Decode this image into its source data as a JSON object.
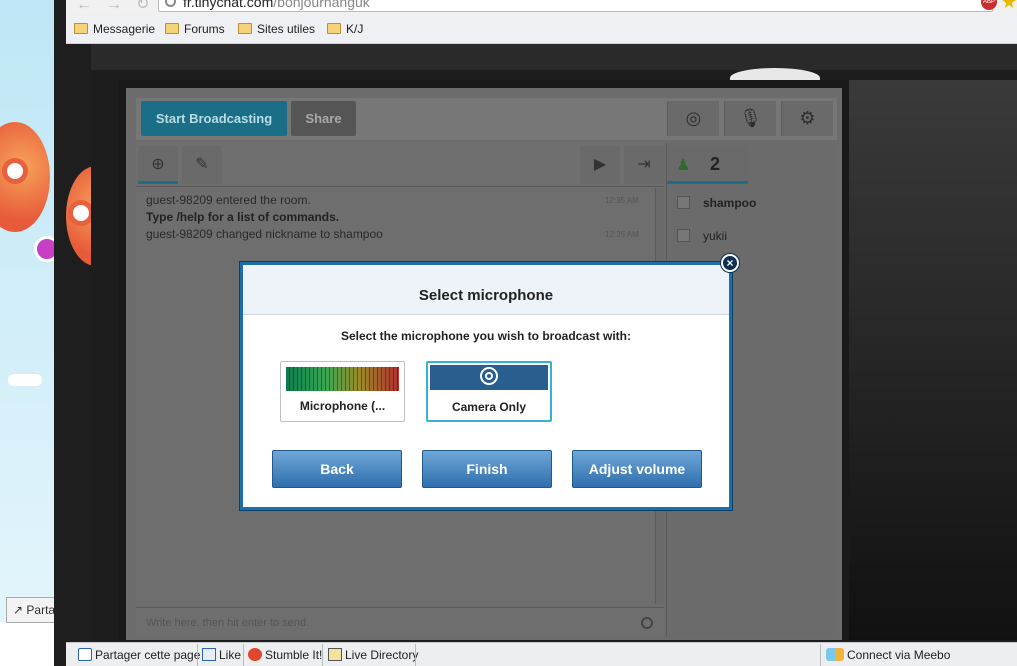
{
  "browser": {
    "url_host": "fr.tinychat.com",
    "url_path": "/bonjournanguk",
    "bookmarks": [
      {
        "label": "Messagerie"
      },
      {
        "label": "Forums"
      },
      {
        "label": "Sites utiles"
      },
      {
        "label": "K/J"
      }
    ],
    "abp_label": "ABP"
  },
  "background": {
    "partager_label": "Partage"
  },
  "app": {
    "start_broadcasting_label": "Start Broadcasting",
    "share_label": "Share",
    "messages": [
      {
        "text": "guest-98209 entered the room.",
        "time": "12:35 AM",
        "bold": false
      },
      {
        "text": "Type /help for a list of commands.",
        "time": "",
        "bold": true
      },
      {
        "text": "guest-98209 changed nickname to shampoo",
        "time": "12:35 AM",
        "bold": false
      }
    ],
    "input_placeholder": "Write here, then hit enter to send.",
    "user_count": "2",
    "users": [
      "shampoo",
      "yukii"
    ]
  },
  "dialog": {
    "title": "Select microphone",
    "subtitle": "Select the microphone you wish to broadcast with:",
    "options": [
      {
        "label": "Microphone (..."
      },
      {
        "label": "Camera Only"
      }
    ],
    "buttons": {
      "back": "Back",
      "finish": "Finish",
      "adjust_volume": "Adjust volume"
    },
    "close_symbol": "×"
  },
  "bottom_bar": {
    "share_page": "Partager cette page",
    "like": "Like",
    "stumble": "Stumble It!",
    "live_directory": "Live Directory",
    "meebo": "Connect via Meebo"
  },
  "colors": {
    "accent": "#1a6f87",
    "dialog_border": "#1e6fa8",
    "button_blue": "#2f6fad",
    "selected_option": "#36b1d6"
  }
}
